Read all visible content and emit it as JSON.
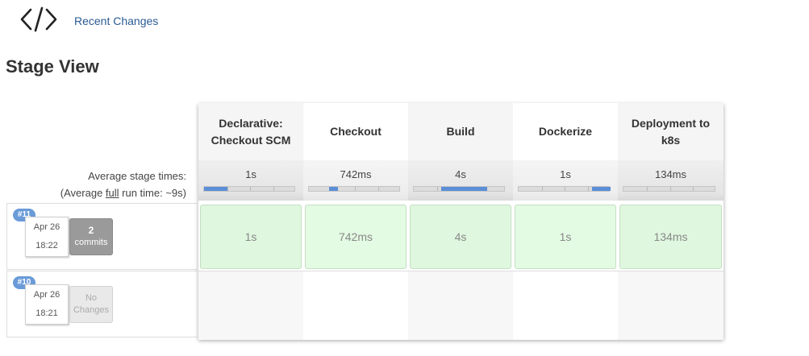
{
  "header": {
    "code_icon": "code-brackets-icon",
    "recent_changes": "Recent Changes",
    "title": "Stage View"
  },
  "averages": {
    "label_line1": "Average stage times:",
    "label_line2_prefix": "(Average ",
    "label_line2_link": "full",
    "label_line2_suffix": " run time: ~9s)"
  },
  "stages": [
    {
      "name": "Declarative: Checkout SCM",
      "avg": "1s",
      "avg_fraction": 0.25
    },
    {
      "name": "Checkout",
      "avg": "742ms",
      "avg_fraction": 0.1
    },
    {
      "name": "Build",
      "avg": "4s",
      "avg_fraction": 0.5
    },
    {
      "name": "Dockerize",
      "avg": "1s",
      "avg_fraction": 0.2
    },
    {
      "name": "Deployment to k8s",
      "avg": "134ms",
      "avg_fraction": 0.02
    }
  ],
  "runs": [
    {
      "id": "#11",
      "date": "Apr 26",
      "time": "18:22",
      "changes_count": "2",
      "changes_word": "commits",
      "stage_times": [
        "1s",
        "742ms",
        "4s",
        "1s",
        "134ms"
      ]
    },
    {
      "id": "#10",
      "date": "Apr 26",
      "time": "18:21",
      "changes_line1": "No",
      "changes_line2": "Changes",
      "stage_times": []
    }
  ],
  "colors": {
    "success": "#dff7df",
    "badge": "#6a9bd8",
    "link": "#2b5b94"
  }
}
